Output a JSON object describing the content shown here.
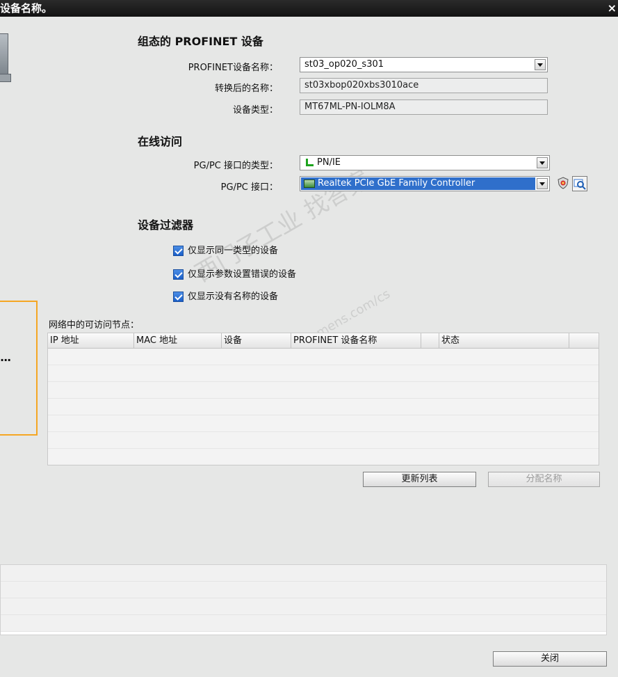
{
  "window": {
    "title": "设备名称。",
    "close_glyph": "×"
  },
  "left_panel": {
    "ellipsis": "..."
  },
  "configured_device": {
    "section_title": "组态的 PROFINET 设备",
    "name_label": "PROFINET设备名称：",
    "name_value": "st03_op020_s301",
    "converted_label": "转换后的名称：",
    "converted_value": "st03xbop020xbs3010ace",
    "type_label": "设备类型：",
    "type_value": "MT67ML-PN-IOLM8A"
  },
  "online_access": {
    "section_title": "在线访问",
    "iface_type_label": "PG/PC 接口的类型：",
    "iface_type_value": "PN/IE",
    "iface_label": "PG/PC 接口：",
    "iface_value": "Realtek PCIe GbE Family Controller",
    "iface_type_icon": "pnie-icon",
    "iface_icon": "network-card-icon"
  },
  "device_filter": {
    "section_title": "设备过滤器",
    "options": [
      {
        "label": "仅显示同一类型的设备",
        "checked": true
      },
      {
        "label": "仅显示参数设置错误的设备",
        "checked": true
      },
      {
        "label": "仅显示没有名称的设备",
        "checked": true
      }
    ]
  },
  "nodes_table": {
    "caption": "网络中的可访问节点：",
    "columns": [
      "IP 地址",
      "MAC 地址",
      "设备",
      "PROFINET 设备名称",
      "状态"
    ],
    "rows": []
  },
  "buttons": {
    "refresh": "更新列表",
    "assign": "分配名称",
    "close": "关闭"
  },
  "watermark": {
    "line1": "西门子工业  找答案",
    "line2": "support.industry.siemens.com/cs"
  },
  "colors": {
    "highlight": "#2f6fcb",
    "orange_border": "#f5a623",
    "titlebar": "#1a1a1a"
  }
}
